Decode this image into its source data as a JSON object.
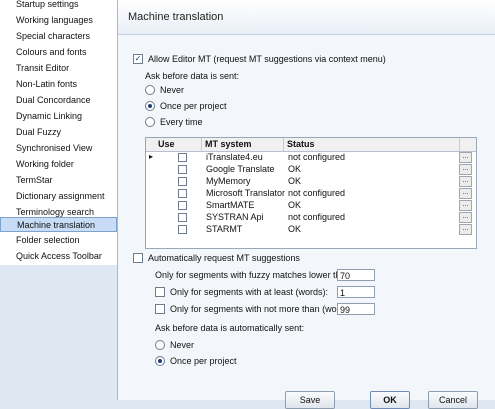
{
  "sidebar": {
    "items": [
      {
        "label": "Startup settings"
      },
      {
        "label": "Working languages"
      },
      {
        "label": "Special characters"
      },
      {
        "label": "Colours and fonts"
      },
      {
        "label": "Transit Editor"
      },
      {
        "label": "Non-Latin fonts"
      },
      {
        "label": "Dual Concordance"
      },
      {
        "label": "Dynamic Linking"
      },
      {
        "label": "Dual Fuzzy"
      },
      {
        "label": "Synchronised View"
      },
      {
        "label": "Working folder"
      },
      {
        "label": "TermStar"
      },
      {
        "label": "Dictionary assignment"
      },
      {
        "label": "Terminology search"
      },
      {
        "label": "Machine translation"
      },
      {
        "label": "Folder selection"
      },
      {
        "label": "Quick Access Toolbar"
      }
    ],
    "selected": "Machine translation"
  },
  "header": {
    "title": "Machine translation"
  },
  "allow_mt": {
    "label": "Allow Editor MT (request MT suggestions via context menu)",
    "checked": true
  },
  "ask_before": {
    "label": "Ask before data is sent:",
    "options": [
      {
        "label": "Never",
        "selected": false
      },
      {
        "label": "Once per project",
        "selected": true
      },
      {
        "label": "Every time",
        "selected": false
      }
    ]
  },
  "table": {
    "columns": [
      "Use",
      "MT system",
      "Status"
    ],
    "rows": [
      {
        "system": "iTranslate4.eu",
        "status": "not configured"
      },
      {
        "system": "Google Translate",
        "status": "OK"
      },
      {
        "system": "MyMemory",
        "status": "OK"
      },
      {
        "system": "Microsoft Translator",
        "status": "not configured"
      },
      {
        "system": "SmartMATE",
        "status": "OK"
      },
      {
        "system": "SYSTRAN Api",
        "status": "not configured"
      },
      {
        "system": "STARMT",
        "status": "OK"
      }
    ],
    "button_label": "..."
  },
  "auto_request": {
    "label": "Automatically request MT suggestions"
  },
  "fuzzy_threshold": {
    "label": "Only for segments with fuzzy matches lower than (%):",
    "value": "70"
  },
  "min_words": {
    "label": "Only for segments with at least (words):",
    "value": "1"
  },
  "max_words": {
    "label": "Only for segments with not more than (words):",
    "value": "99"
  },
  "auto_ask_before": {
    "label": "Ask before data is automatically sent:",
    "options": [
      {
        "label": "Never",
        "selected": false
      },
      {
        "label": "Once per project",
        "selected": true
      }
    ]
  },
  "buttons": {
    "save": "Save",
    "ok": "OK",
    "cancel": "Cancel"
  }
}
